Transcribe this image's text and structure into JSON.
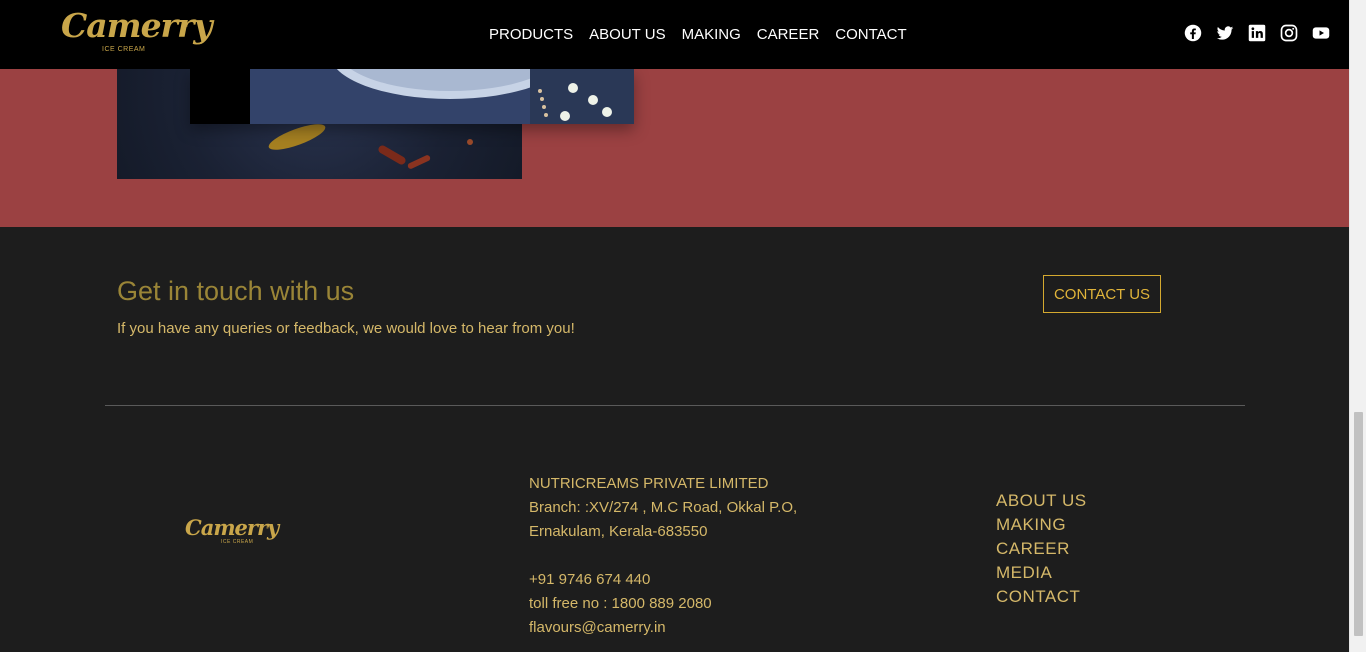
{
  "brand": {
    "name": "Camerry",
    "tagline": "ICE CREAM",
    "trademark": "®"
  },
  "nav": {
    "items": [
      {
        "label": "PRODUCTS"
      },
      {
        "label": "ABOUT US"
      },
      {
        "label": "MAKING"
      },
      {
        "label": "CAREER"
      },
      {
        "label": "CONTACT"
      }
    ]
  },
  "social": {
    "icons": [
      "facebook-icon",
      "twitter-icon",
      "linkedin-icon",
      "instagram-icon",
      "youtube-icon"
    ]
  },
  "touch": {
    "title": "Get in touch with us",
    "subtitle": "If you have any queries or feedback, we would love to hear from you!",
    "button_label": "CONTACT US"
  },
  "footer": {
    "company": "NUTRICREAMS PRIVATE LIMITED",
    "address_line1": "Branch: :XV/274 , M.C Road, Okkal P.O,",
    "address_line2": "Ernakulam, Kerala-683550",
    "phone": "+91 9746 674 440",
    "toll_free": "toll free no : 1800 889 2080",
    "email": "flavours@camerry.in",
    "links": [
      {
        "label": "ABOUT US"
      },
      {
        "label": "MAKING"
      },
      {
        "label": "CAREER"
      },
      {
        "label": "MEDIA"
      },
      {
        "label": "CONTACT"
      }
    ]
  },
  "colors": {
    "header_bg": "#000000",
    "band": "#9b4142",
    "footer_bg": "#1d1d1d",
    "gold": "#c9a64a",
    "gold_text": "#d5b869",
    "title_gold": "#9a8537"
  }
}
